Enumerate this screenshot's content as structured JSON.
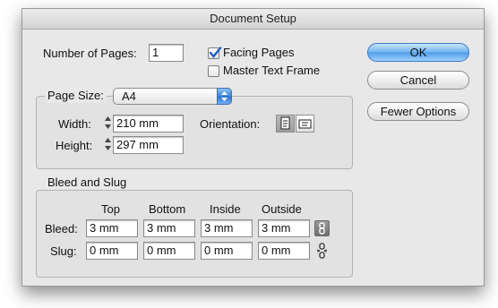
{
  "window": {
    "title": "Document Setup"
  },
  "pages": {
    "label": "Number of Pages:",
    "value": "1"
  },
  "options": {
    "facing_pages": {
      "label": "Facing Pages",
      "checked": true
    },
    "master_text_frame": {
      "label": "Master Text Frame",
      "checked": false
    }
  },
  "buttons": {
    "ok": "OK",
    "cancel": "Cancel",
    "fewer_options": "Fewer Options"
  },
  "page_size": {
    "label": "Page Size:",
    "selected": "A4",
    "width_label": "Width:",
    "width_value": "210 mm",
    "height_label": "Height:",
    "height_value": "297 mm",
    "orientation_label": "Orientation:",
    "orientation_selected": "portrait"
  },
  "bleed_slug": {
    "title": "Bleed and Slug",
    "columns": [
      "Top",
      "Bottom",
      "Inside",
      "Outside"
    ],
    "bleed_label": "Bleed:",
    "bleed_values": [
      "3 mm",
      "3 mm",
      "3 mm",
      "3 mm"
    ],
    "slug_label": "Slug:",
    "slug_values": [
      "0 mm",
      "0 mm",
      "0 mm",
      "0 mm"
    ],
    "bleed_linked": true,
    "slug_linked": false
  },
  "colors": {
    "accent": "#4f9ce6",
    "dialog_bg": "#e8e8e8"
  }
}
